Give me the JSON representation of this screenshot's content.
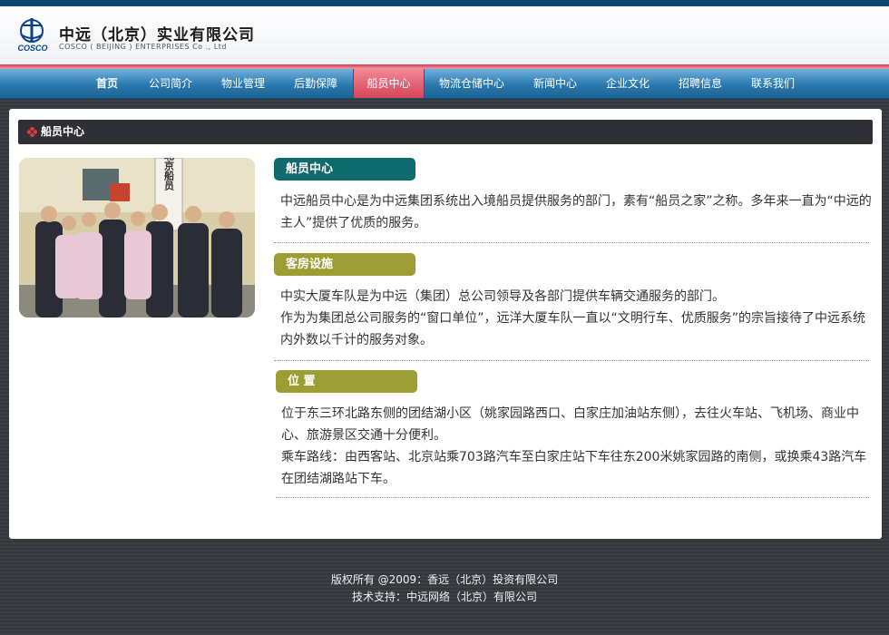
{
  "header": {
    "logo_text": "COSCO",
    "company_cn": "中远（北京）实业有限公司",
    "company_en": "COSCO ( BEIJING ) ENTERPRISES Co ., Ltd"
  },
  "nav": {
    "items": [
      {
        "label": "首页"
      },
      {
        "label": "公司简介"
      },
      {
        "label": "物业管理"
      },
      {
        "label": "后勤保障"
      },
      {
        "label": "船员中心"
      },
      {
        "label": "物流仓储中心"
      },
      {
        "label": "新闻中心"
      },
      {
        "label": "企业文化"
      },
      {
        "label": "招聘信息"
      },
      {
        "label": "联系我们"
      }
    ],
    "active_index": 4
  },
  "page": {
    "title": "船员中心"
  },
  "sections": [
    {
      "tag": "船员中心",
      "color": "#0f6a6e",
      "paragraphs": [
        "中远船员中心是为中远集团系统出入境船员提供服务的部门，素有“船员之家”之称。多年来一直为“中远的主人”提供了优质的服务。"
      ]
    },
    {
      "tag": "客房设施",
      "color": "#9c9e34",
      "paragraphs": [
        "中实大厦车队是为中远（集团）总公司领导及各部门提供车辆交通服务的部门。",
        "作为为集团总公司服务的“窗口单位”，远洋大厦车队一直以“文明行车、优质服务”的宗旨接待了中远系统内外数以千计的服务对象。"
      ]
    },
    {
      "tag": "位 置",
      "color": "#9c9e34",
      "paragraphs": [
        "位于东三环北路东侧的团结湖小区（姚家园路西口、白家庄加油站东侧），去往火车站、飞机场、商业中心、旅游景区交通十分便利。",
        "乘车路线：由西客站、北京站乘703路汽车至白家庄站下车往东200米姚家园路的南侧，或换乘43路汽车在团结湖路站下车。"
      ]
    }
  ],
  "photo": {
    "sign_text": "北京船员"
  },
  "footer": {
    "copyright": "版权所有 @2009：香远（北京）投资有限公司",
    "support": "技术支持：中远网络（北京）有限公司"
  }
}
